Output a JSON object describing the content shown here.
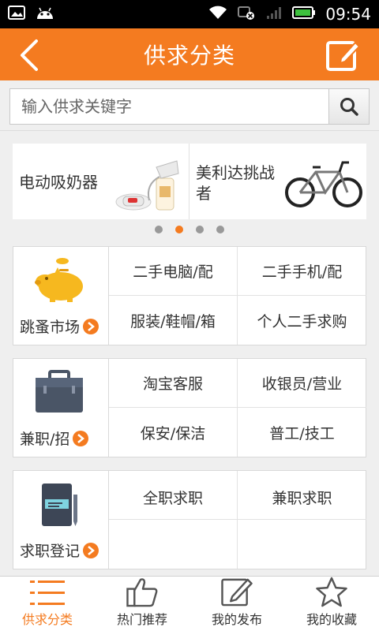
{
  "status": {
    "time": "09:54"
  },
  "header": {
    "title": "供求分类"
  },
  "search": {
    "placeholder": "输入供求关键字"
  },
  "banner": {
    "items": [
      {
        "label": "电动吸奶器"
      },
      {
        "label_line1": "美利达挑战",
        "label_line2": "者"
      }
    ],
    "page_count": 4,
    "active_index": 1
  },
  "categories": [
    {
      "name": "跳蚤市场",
      "icon": "piggy-bank-icon",
      "subs": [
        "二手电脑/配",
        "二手手机/配",
        "服装/鞋帽/箱",
        "个人二手求购"
      ]
    },
    {
      "name": "兼职/招",
      "icon": "briefcase-icon",
      "subs": [
        "淘宝客服",
        "收银员/营业",
        "保安/保洁",
        "普工/技工"
      ]
    },
    {
      "name": "求职登记",
      "icon": "notebook-icon",
      "subs": [
        "全职求职",
        "兼职求职",
        "",
        ""
      ]
    }
  ],
  "nav": {
    "items": [
      {
        "label": "供求分类",
        "icon": "list-icon",
        "active": true
      },
      {
        "label": "热门推荐",
        "icon": "thumbs-up-icon",
        "active": false
      },
      {
        "label": "我的发布",
        "icon": "edit-icon",
        "active": false
      },
      {
        "label": "我的收藏",
        "icon": "star-icon",
        "active": false
      }
    ]
  },
  "colors": {
    "accent": "#f47b20",
    "background": "#efefef"
  }
}
